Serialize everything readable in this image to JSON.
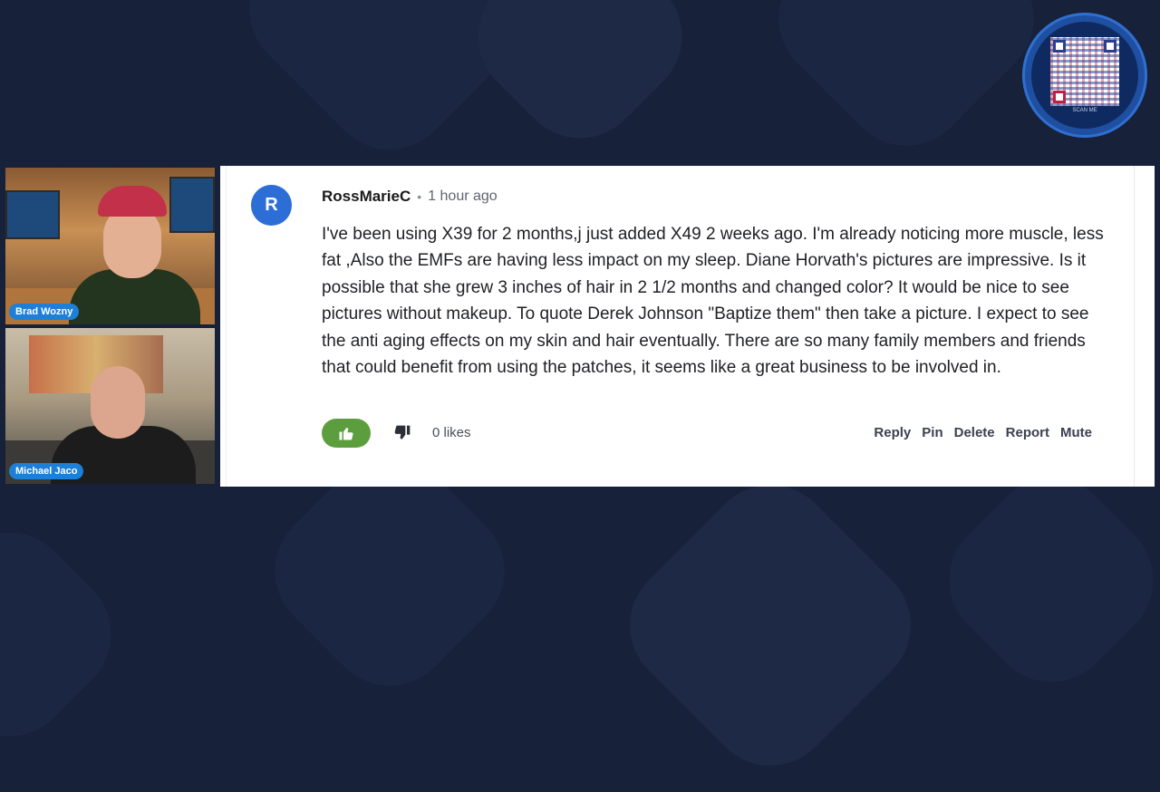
{
  "participants": [
    {
      "name": "Brad Wozny"
    },
    {
      "name": "Michael Jaco"
    }
  ],
  "comment": {
    "avatar_letter": "R",
    "author": "RossMarieC",
    "separator": "•",
    "time": "1 hour ago",
    "text": "I've been using X39 for 2 months,j just added X49 2 weeks ago. I'm already noticing more muscle, less fat ,Also the EMFs are having less impact on my sleep. Diane Horvath's pictures are impressive. Is it possible that she grew 3 inches of hair in 2 1/2 months and changed color? It would be nice to see pictures without makeup. To quote Derek Johnson \"Baptize them\" then take a picture. I expect to see the anti aging effects on my skin and hair eventually. There are so many family members and friends that could benefit from using the patches, it seems like a great business to be involved in.",
    "likes": "0 likes",
    "actions": {
      "reply": "Reply",
      "pin": "Pin",
      "delete": "Delete",
      "report": "Report",
      "mute": "Mute"
    }
  },
  "qr": {
    "caption": "SCAN ME"
  },
  "colors": {
    "background": "#17213a",
    "avatar": "#2d6ed6",
    "like_button": "#5c9e3d",
    "name_tag": "#1e7fd6"
  },
  "icons": {
    "like": "thumbs-up-icon",
    "dislike": "thumbs-down-icon",
    "qr": "qr-code-icon"
  }
}
